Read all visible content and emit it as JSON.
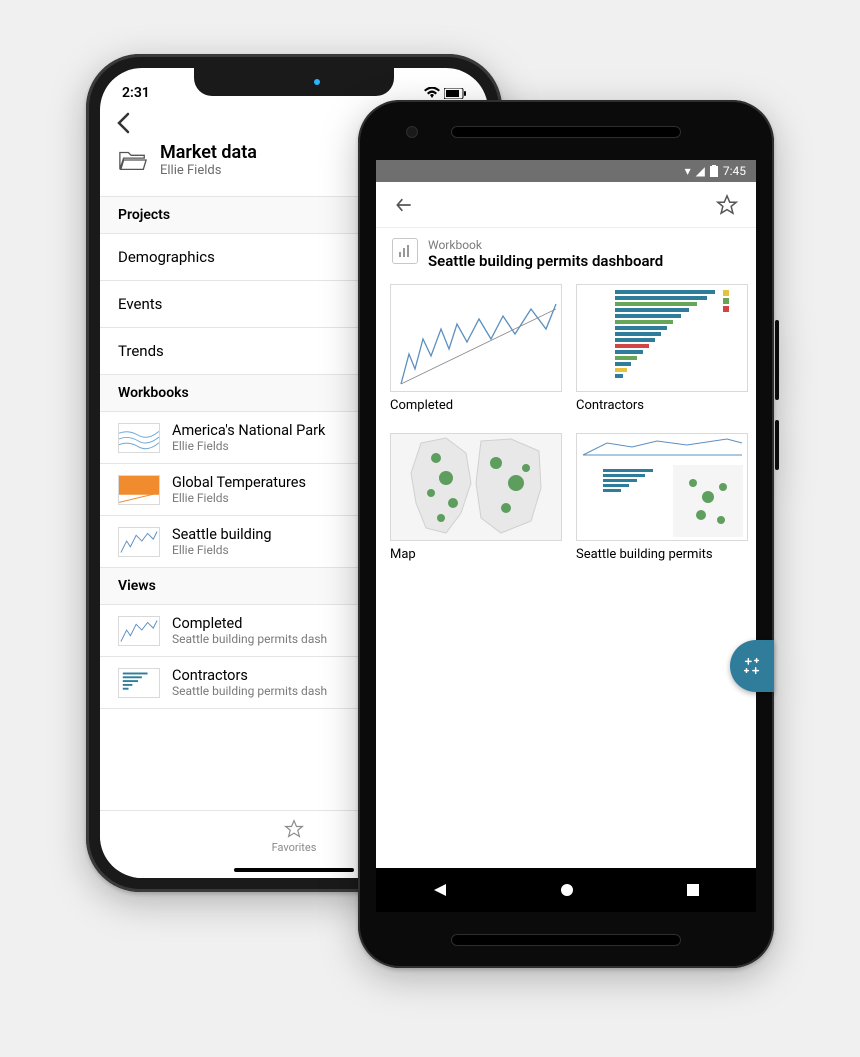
{
  "iphone": {
    "status_time": "2:31",
    "header_title": "Market data",
    "header_owner": "Ellie Fields",
    "section_projects": "Projects",
    "section_workbooks": "Workbooks",
    "section_views": "Views",
    "projects": [
      {
        "label": "Demographics"
      },
      {
        "label": "Events"
      },
      {
        "label": "Trends"
      }
    ],
    "workbooks": [
      {
        "title": "America's National Park",
        "owner": "Ellie Fields"
      },
      {
        "title": "Global Temperatures",
        "owner": "Ellie Fields"
      },
      {
        "title": "Seattle building",
        "owner": "Ellie Fields"
      }
    ],
    "views": [
      {
        "title": "Completed",
        "sub": "Seattle building permits dash"
      },
      {
        "title": "Contractors",
        "sub": "Seattle building permits dash"
      }
    ],
    "tab_favorites": "Favorites"
  },
  "android": {
    "status_time": "7:45",
    "type_label": "Workbook",
    "title": "Seattle building permits dashboard",
    "grid": [
      {
        "label": "Completed"
      },
      {
        "label": "Contractors"
      },
      {
        "label": "Map"
      },
      {
        "label": "Seattle building permits"
      }
    ]
  }
}
